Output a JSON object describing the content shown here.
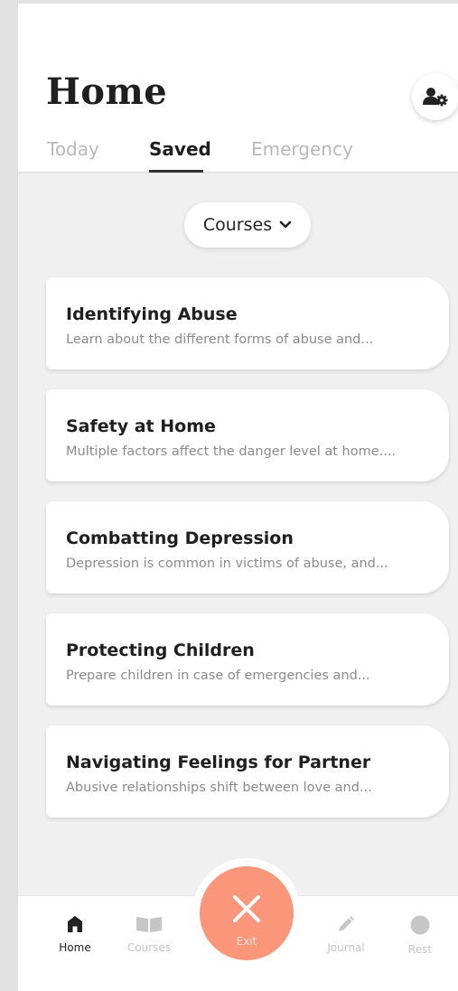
{
  "header": {
    "title": "Home",
    "settings_icon": "user-settings-icon",
    "tabs": [
      "Today",
      "Saved",
      "Emergency"
    ],
    "active_tab": "Saved"
  },
  "filter": {
    "label": "Courses",
    "icon": "chevron-down-icon"
  },
  "courses": [
    {
      "title": "Identifying Abuse",
      "description": "Learn about the different forms of abuse and..."
    },
    {
      "title": "Safety at Home",
      "description": "Multiple factors affect the danger level at home...."
    },
    {
      "title": "Combatting Depression",
      "description": "Depression is common in victims of abuse, and..."
    },
    {
      "title": "Protecting Children",
      "description": "Prepare children in case of emergencies and..."
    },
    {
      "title": "Navigating Feelings for Partner",
      "description": "Abusive relationships shift between love and..."
    }
  ],
  "bottom_nav": {
    "home": "Home",
    "courses": "Courses",
    "exit": "Exit",
    "journal": "Journal",
    "rest": "Rest"
  },
  "colors": {
    "accent": "#fa9679",
    "background": "#f0f0f0",
    "text_dark": "#1f1f1f",
    "text_muted": "#8a8a8a"
  }
}
